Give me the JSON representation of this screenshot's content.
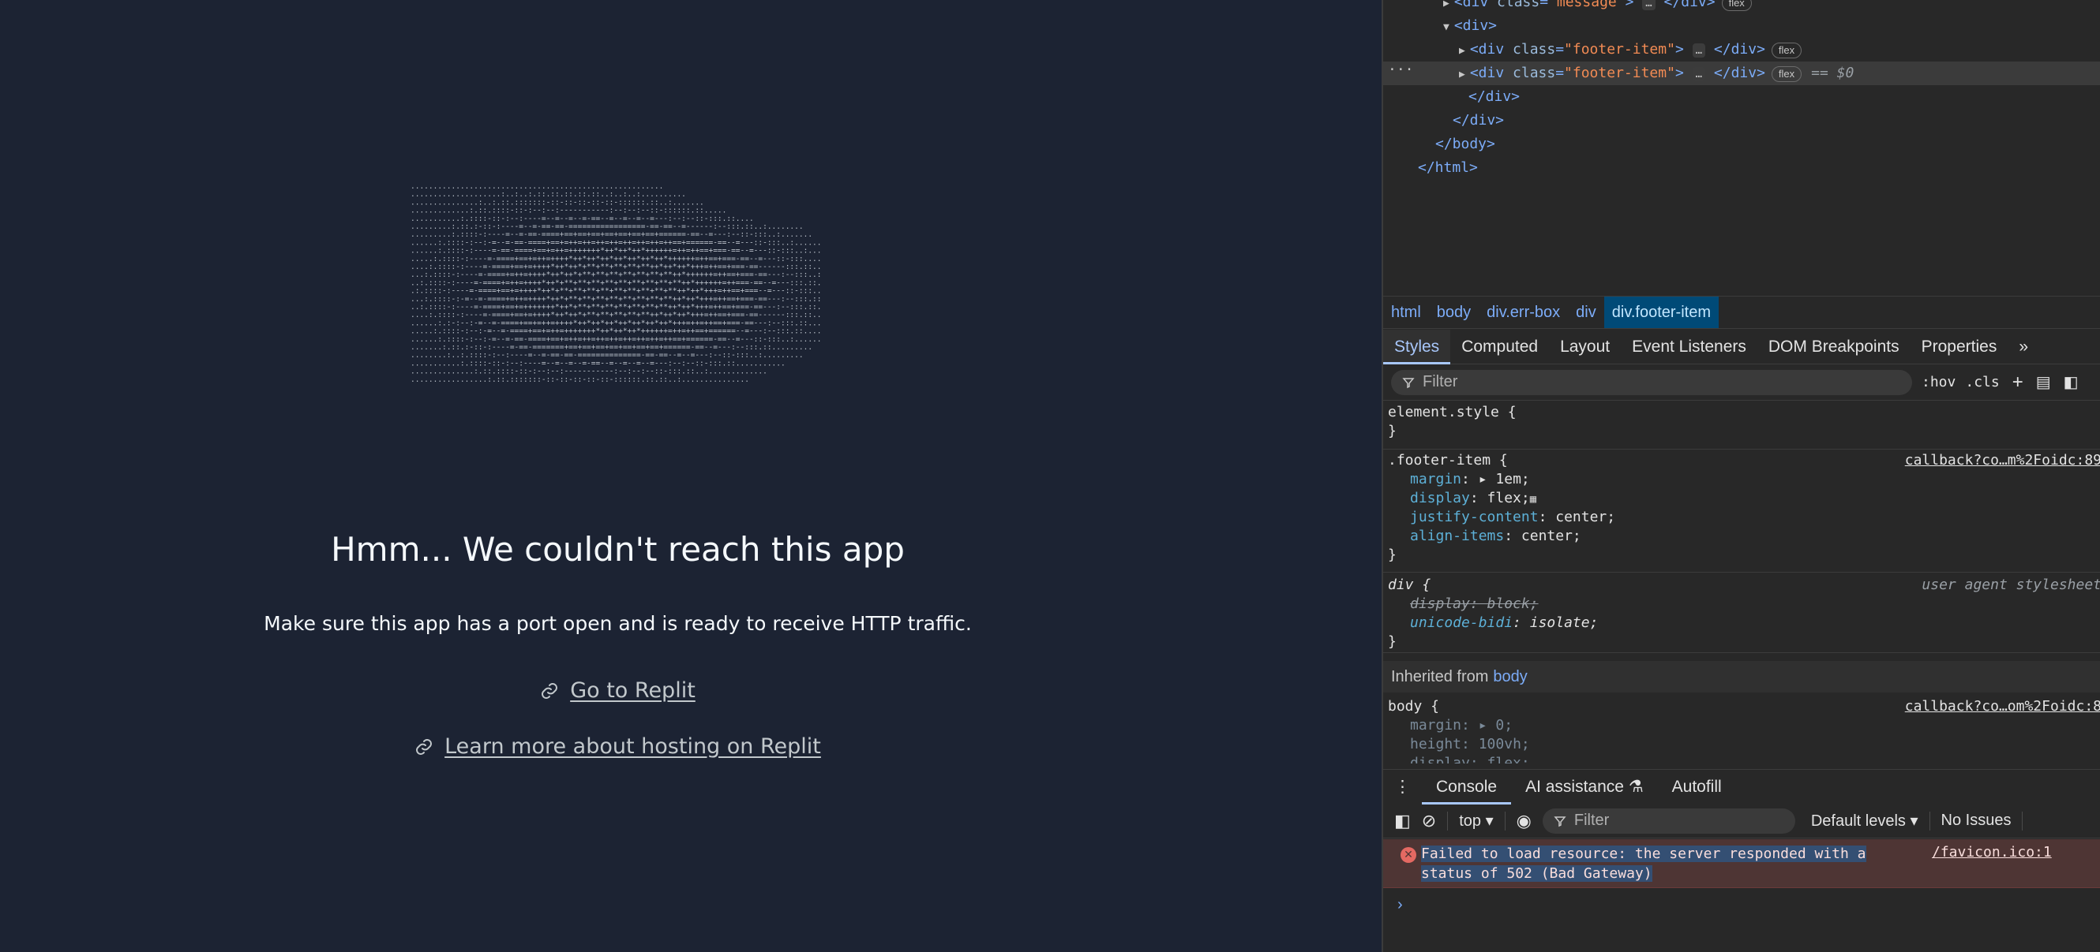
{
  "page": {
    "title": "Hmm... We couldn't reach this app",
    "subtitle": "Make sure this app has a port open and is ready to receive HTTP traffic.",
    "links": [
      "Go to Replit",
      "Learn more about hosting on Replit"
    ]
  },
  "devtools": {
    "dom": {
      "line0_class": "\"message\"",
      "div_open": "<div>",
      "footer_class": "\"footer-item\"",
      "div_close": "</div>",
      "body_close": "</body>",
      "html_close": "</html>",
      "badge": "flex",
      "selected_marker": "== $0",
      "dots": "…"
    },
    "breadcrumbs": [
      "html",
      "body",
      "div.err-box",
      "div",
      "div.footer-item"
    ],
    "tabs": [
      "Styles",
      "Computed",
      "Layout",
      "Event Listeners",
      "DOM Breakpoints",
      "Properties"
    ],
    "styles_filter_placeholder": "Filter",
    "toolbar": {
      "hov": ":hov",
      "cls": ".cls"
    },
    "styles": {
      "element_style": "element.style {",
      "close": "}",
      "footer_selector": ".footer-item {",
      "footer_source": "callback?co…m%2Foidc:89",
      "footer_props": [
        {
          "name": "margin",
          "value": "▸ 1em;"
        },
        {
          "name": "display",
          "value": "flex;"
        },
        {
          "name": "justify-content",
          "value": "center;"
        },
        {
          "name": "align-items",
          "value": "center;"
        }
      ],
      "div_selector": "div {",
      "ua_label": "user agent stylesheet",
      "div_props": [
        {
          "name": "display",
          "value": "block;"
        },
        {
          "name": "unicode-bidi",
          "value": "isolate;"
        }
      ],
      "inherited_label": "Inherited from",
      "inherited_el": "body",
      "body_selector": "body {",
      "body_source": "callback?co…om%2Foidc:8",
      "body_props": [
        {
          "name": "margin",
          "value": "▸ 0;"
        },
        {
          "name": "height",
          "value": "100vh;"
        },
        {
          "name": "display",
          "value": "flex;"
        }
      ]
    },
    "drawer_tabs": [
      "Console",
      "AI assistance",
      "Autofill"
    ],
    "console": {
      "context": "top",
      "filter_placeholder": "Filter",
      "levels": "Default levels",
      "issues": "No Issues",
      "error_line1": "Failed to load resource: the server responded with a",
      "error_line2": "status of 502 (Bad Gateway)",
      "error_source": "/favicon.ico:1",
      "prompt": "›"
    }
  },
  "colors": {
    "page_bg": "#1c2333",
    "devtools_bg": "#282828",
    "accent": "#a8c7fa",
    "error_bg": "#4e3534"
  }
}
